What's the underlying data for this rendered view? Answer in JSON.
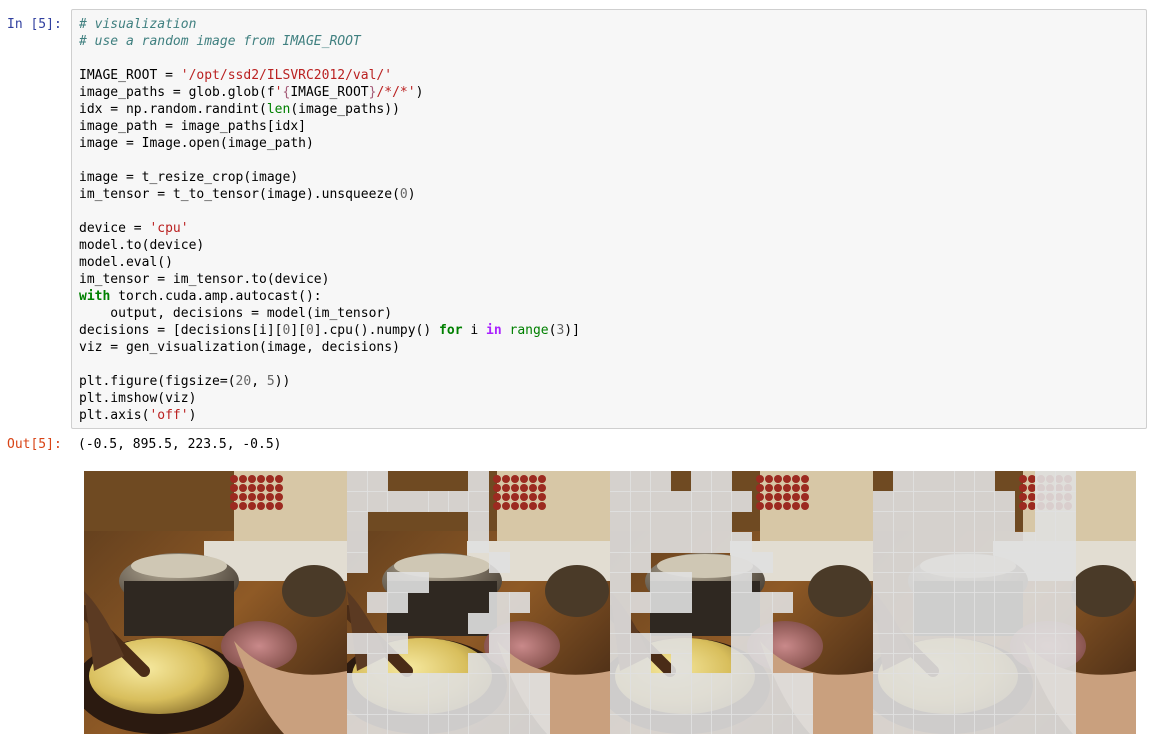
{
  "cell": {
    "input_prompt": "In [5]:",
    "output_prompt": "Out[5]:",
    "output_text": "(-0.5, 895.5, 223.5, -0.5)"
  },
  "code_lines": [
    [
      {
        "t": "# visualization",
        "c": "comment"
      }
    ],
    [
      {
        "t": "# use a random image from IMAGE_ROOT",
        "c": "comment"
      }
    ],
    [],
    [
      {
        "t": "IMAGE_ROOT = "
      },
      {
        "t": "'/opt/ssd2/ILSVRC2012/val/'",
        "c": "string"
      }
    ],
    [
      {
        "t": "image_paths = glob.glob(f"
      },
      {
        "t": "'",
        "c": "string"
      },
      {
        "t": "{",
        "c": "interp"
      },
      {
        "t": "IMAGE_ROOT"
      },
      {
        "t": "}",
        "c": "interp"
      },
      {
        "t": "/*/*'",
        "c": "string"
      },
      {
        "t": ")"
      }
    ],
    [
      {
        "t": "idx = np.random.randint("
      },
      {
        "t": "len",
        "c": "builtin"
      },
      {
        "t": "(image_paths))"
      }
    ],
    [
      {
        "t": "image_path = image_paths[idx]"
      }
    ],
    [
      {
        "t": "image = Image.open(image_path)"
      }
    ],
    [],
    [
      {
        "t": "image = t_resize_crop(image)"
      }
    ],
    [
      {
        "t": "im_tensor = t_to_tensor(image).unsqueeze("
      },
      {
        "t": "0",
        "c": "number"
      },
      {
        "t": ")"
      }
    ],
    [],
    [
      {
        "t": "device = "
      },
      {
        "t": "'cpu'",
        "c": "string"
      }
    ],
    [
      {
        "t": "model.to(device)"
      }
    ],
    [
      {
        "t": "model.eval()"
      }
    ],
    [
      {
        "t": "im_tensor = im_tensor.to(device)"
      }
    ],
    [
      {
        "t": "with",
        "c": "keyword"
      },
      {
        "t": " torch.cuda.amp.autocast():"
      }
    ],
    [
      {
        "t": "    output, decisions = model(im_tensor)"
      }
    ],
    [
      {
        "t": "decisions = [decisions[i]["
      },
      {
        "t": "0",
        "c": "number"
      },
      {
        "t": "]["
      },
      {
        "t": "0",
        "c": "number"
      },
      {
        "t": "].cpu().numpy() "
      },
      {
        "t": "for",
        "c": "keyword"
      },
      {
        "t": " i "
      },
      {
        "t": "in",
        "c": "operator"
      },
      {
        "t": " "
      },
      {
        "t": "range",
        "c": "builtin"
      },
      {
        "t": "("
      },
      {
        "t": "3",
        "c": "number"
      },
      {
        "t": ")]"
      }
    ],
    [
      {
        "t": "viz = gen_visualization(image, decisions)"
      }
    ],
    [],
    [
      {
        "t": "plt.figure(figsize=("
      },
      {
        "t": "20",
        "c": "number"
      },
      {
        "t": ", "
      },
      {
        "t": "5",
        "c": "number"
      },
      {
        "t": "))"
      }
    ],
    [
      {
        "t": "plt.imshow(viz)"
      }
    ],
    [
      {
        "t": "plt.axis("
      },
      {
        "t": "'off'",
        "c": "string"
      },
      {
        "t": ")"
      }
    ]
  ],
  "colors": {
    "comment": "#408080",
    "string": "#ba2121",
    "interp": "#a45a77",
    "builtin": "#008000",
    "keyword": "#008000",
    "operator": "#aa22ff",
    "number": "#666666"
  },
  "figure": {
    "panels": [
      {
        "masked_cells": []
      },
      {
        "masked_cells": [
          [
            0,
            0
          ],
          [
            0,
            1
          ],
          [
            0,
            6
          ],
          [
            1,
            0
          ],
          [
            1,
            1
          ],
          [
            1,
            2
          ],
          [
            1,
            3
          ],
          [
            1,
            4
          ],
          [
            1,
            5
          ],
          [
            1,
            6
          ],
          [
            2,
            0
          ],
          [
            2,
            6
          ],
          [
            3,
            0
          ],
          [
            3,
            6
          ],
          [
            4,
            0
          ],
          [
            4,
            7
          ],
          [
            5,
            2
          ],
          [
            5,
            3
          ],
          [
            6,
            1
          ],
          [
            6,
            2
          ],
          [
            6,
            7
          ],
          [
            6,
            8
          ],
          [
            7,
            6
          ],
          [
            7,
            7
          ],
          [
            8,
            0
          ],
          [
            8,
            1
          ],
          [
            8,
            2
          ],
          [
            8,
            7
          ],
          [
            9,
            1
          ],
          [
            9,
            6
          ],
          [
            9,
            7
          ],
          [
            10,
            0
          ],
          [
            10,
            1
          ],
          [
            10,
            2
          ],
          [
            10,
            3
          ],
          [
            10,
            4
          ],
          [
            10,
            5
          ],
          [
            10,
            6
          ],
          [
            10,
            7
          ],
          [
            10,
            8
          ],
          [
            10,
            9
          ],
          [
            11,
            0
          ],
          [
            11,
            1
          ],
          [
            11,
            2
          ],
          [
            11,
            3
          ],
          [
            11,
            4
          ],
          [
            11,
            5
          ],
          [
            11,
            6
          ],
          [
            11,
            7
          ],
          [
            11,
            8
          ],
          [
            11,
            9
          ],
          [
            12,
            0
          ],
          [
            12,
            1
          ],
          [
            12,
            2
          ],
          [
            12,
            3
          ],
          [
            12,
            4
          ],
          [
            12,
            5
          ],
          [
            12,
            6
          ],
          [
            12,
            7
          ],
          [
            12,
            8
          ],
          [
            12,
            9
          ]
        ]
      },
      {
        "masked_cells": [
          [
            0,
            0
          ],
          [
            0,
            1
          ],
          [
            0,
            2
          ],
          [
            0,
            4
          ],
          [
            0,
            5
          ],
          [
            1,
            0
          ],
          [
            1,
            1
          ],
          [
            1,
            2
          ],
          [
            1,
            3
          ],
          [
            1,
            4
          ],
          [
            1,
            5
          ],
          [
            1,
            6
          ],
          [
            2,
            0
          ],
          [
            2,
            1
          ],
          [
            2,
            2
          ],
          [
            2,
            3
          ],
          [
            2,
            4
          ],
          [
            2,
            5
          ],
          [
            3,
            0
          ],
          [
            3,
            1
          ],
          [
            3,
            2
          ],
          [
            3,
            3
          ],
          [
            3,
            4
          ],
          [
            3,
            5
          ],
          [
            3,
            6
          ],
          [
            4,
            0
          ],
          [
            4,
            1
          ],
          [
            4,
            6
          ],
          [
            4,
            7
          ],
          [
            5,
            0
          ],
          [
            5,
            2
          ],
          [
            5,
            3
          ],
          [
            5,
            6
          ],
          [
            6,
            0
          ],
          [
            6,
            1
          ],
          [
            6,
            2
          ],
          [
            6,
            3
          ],
          [
            6,
            6
          ],
          [
            6,
            7
          ],
          [
            6,
            8
          ],
          [
            7,
            0
          ],
          [
            7,
            6
          ],
          [
            7,
            7
          ],
          [
            8,
            0
          ],
          [
            8,
            1
          ],
          [
            8,
            2
          ],
          [
            8,
            3
          ],
          [
            8,
            6
          ],
          [
            8,
            7
          ],
          [
            9,
            0
          ],
          [
            9,
            1
          ],
          [
            9,
            3
          ],
          [
            9,
            6
          ],
          [
            9,
            7
          ],
          [
            10,
            0
          ],
          [
            10,
            1
          ],
          [
            10,
            2
          ],
          [
            10,
            3
          ],
          [
            10,
            4
          ],
          [
            10,
            5
          ],
          [
            10,
            6
          ],
          [
            10,
            7
          ],
          [
            10,
            8
          ],
          [
            10,
            9
          ],
          [
            11,
            0
          ],
          [
            11,
            1
          ],
          [
            11,
            2
          ],
          [
            11,
            3
          ],
          [
            11,
            4
          ],
          [
            11,
            5
          ],
          [
            11,
            6
          ],
          [
            11,
            7
          ],
          [
            11,
            8
          ],
          [
            11,
            9
          ],
          [
            12,
            0
          ],
          [
            12,
            1
          ],
          [
            12,
            2
          ],
          [
            12,
            3
          ],
          [
            12,
            4
          ],
          [
            12,
            5
          ],
          [
            12,
            6
          ],
          [
            12,
            7
          ],
          [
            12,
            8
          ],
          [
            12,
            9
          ]
        ]
      },
      {
        "masked_cells": [
          [
            0,
            1
          ],
          [
            0,
            2
          ],
          [
            0,
            3
          ],
          [
            0,
            4
          ],
          [
            0,
            5
          ],
          [
            0,
            8
          ],
          [
            0,
            9
          ],
          [
            1,
            0
          ],
          [
            1,
            1
          ],
          [
            1,
            2
          ],
          [
            1,
            3
          ],
          [
            1,
            4
          ],
          [
            1,
            5
          ],
          [
            1,
            6
          ],
          [
            1,
            8
          ],
          [
            1,
            9
          ],
          [
            2,
            0
          ],
          [
            2,
            1
          ],
          [
            2,
            2
          ],
          [
            2,
            3
          ],
          [
            2,
            4
          ],
          [
            2,
            5
          ],
          [
            2,
            6
          ],
          [
            2,
            8
          ],
          [
            2,
            9
          ],
          [
            3,
            0
          ],
          [
            3,
            1
          ],
          [
            3,
            2
          ],
          [
            3,
            3
          ],
          [
            3,
            4
          ],
          [
            3,
            5
          ],
          [
            3,
            6
          ],
          [
            3,
            7
          ],
          [
            3,
            8
          ],
          [
            3,
            9
          ],
          [
            4,
            0
          ],
          [
            4,
            1
          ],
          [
            4,
            2
          ],
          [
            4,
            3
          ],
          [
            4,
            4
          ],
          [
            4,
            5
          ],
          [
            4,
            6
          ],
          [
            4,
            7
          ],
          [
            4,
            8
          ],
          [
            4,
            9
          ],
          [
            5,
            0
          ],
          [
            5,
            1
          ],
          [
            5,
            2
          ],
          [
            5,
            3
          ],
          [
            5,
            4
          ],
          [
            5,
            5
          ],
          [
            5,
            6
          ],
          [
            5,
            7
          ],
          [
            5,
            8
          ],
          [
            5,
            9
          ],
          [
            6,
            0
          ],
          [
            6,
            1
          ],
          [
            6,
            2
          ],
          [
            6,
            3
          ],
          [
            6,
            4
          ],
          [
            6,
            5
          ],
          [
            6,
            6
          ],
          [
            6,
            7
          ],
          [
            6,
            8
          ],
          [
            6,
            9
          ],
          [
            7,
            0
          ],
          [
            7,
            1
          ],
          [
            7,
            2
          ],
          [
            7,
            3
          ],
          [
            7,
            4
          ],
          [
            7,
            5
          ],
          [
            7,
            6
          ],
          [
            7,
            7
          ],
          [
            7,
            8
          ],
          [
            7,
            9
          ],
          [
            8,
            0
          ],
          [
            8,
            1
          ],
          [
            8,
            2
          ],
          [
            8,
            3
          ],
          [
            8,
            4
          ],
          [
            8,
            5
          ],
          [
            8,
            6
          ],
          [
            8,
            7
          ],
          [
            8,
            8
          ],
          [
            8,
            9
          ],
          [
            9,
            0
          ],
          [
            9,
            1
          ],
          [
            9,
            2
          ],
          [
            9,
            3
          ],
          [
            9,
            4
          ],
          [
            9,
            5
          ],
          [
            9,
            6
          ],
          [
            9,
            7
          ],
          [
            9,
            8
          ],
          [
            9,
            9
          ],
          [
            10,
            0
          ],
          [
            10,
            1
          ],
          [
            10,
            2
          ],
          [
            10,
            3
          ],
          [
            10,
            4
          ],
          [
            10,
            5
          ],
          [
            10,
            6
          ],
          [
            10,
            7
          ],
          [
            10,
            8
          ],
          [
            10,
            9
          ],
          [
            11,
            0
          ],
          [
            11,
            1
          ],
          [
            11,
            2
          ],
          [
            11,
            3
          ],
          [
            11,
            4
          ],
          [
            11,
            5
          ],
          [
            11,
            6
          ],
          [
            11,
            7
          ],
          [
            11,
            8
          ],
          [
            11,
            9
          ],
          [
            12,
            0
          ],
          [
            12,
            1
          ],
          [
            12,
            2
          ],
          [
            12,
            3
          ],
          [
            12,
            4
          ],
          [
            12,
            5
          ],
          [
            12,
            6
          ],
          [
            12,
            7
          ],
          [
            12,
            8
          ],
          [
            12,
            9
          ]
        ]
      }
    ]
  }
}
